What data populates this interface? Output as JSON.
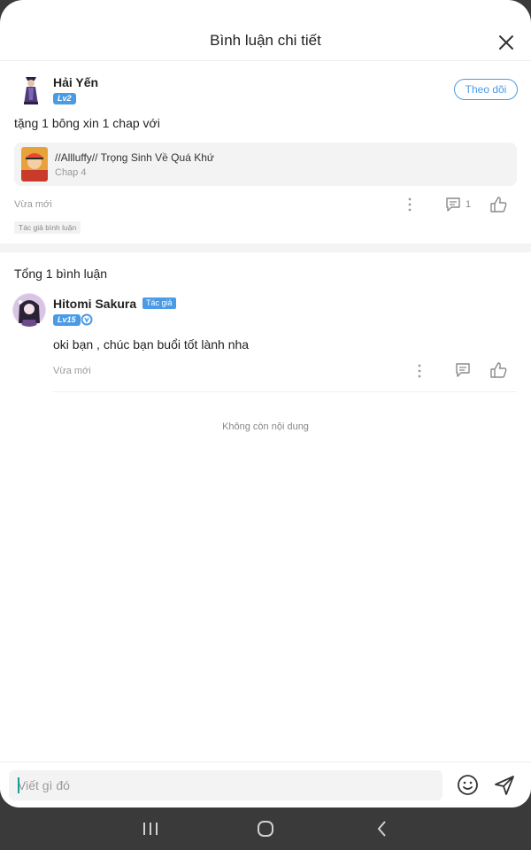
{
  "header": {
    "title": "Bình luận chi tiết",
    "close_icon": "close-icon"
  },
  "main_comment": {
    "user_name": "Hải Yến",
    "level": "Lv2",
    "follow_label": "Theo dõi",
    "text": "tặng 1 bông xin 1 chap với",
    "chapter_card": {
      "title": "//Allluffy// Trọng Sinh Về Quá Khứ",
      "chapter": "Chap 4"
    },
    "time": "Vừa mới",
    "reply_count": "1",
    "author_tag": "Tác giả bình luận"
  },
  "replies_section": {
    "total_label": "Tổng 1 bình luận",
    "replies": [
      {
        "user_name": "Hitomi Sakura",
        "author_badge": "Tác giả",
        "level": "Lv15",
        "text": "oki bạn , chúc bạn buổi tốt lành nha",
        "time": "Vừa mới"
      }
    ],
    "end_text": "Không còn nội dung"
  },
  "input_bar": {
    "placeholder": "Viết gì đó",
    "emoji_icon": "emoji-icon",
    "send_icon": "send-icon"
  },
  "colors": {
    "accent": "#4a9be6",
    "nav_bg": "#3a3a3a"
  }
}
